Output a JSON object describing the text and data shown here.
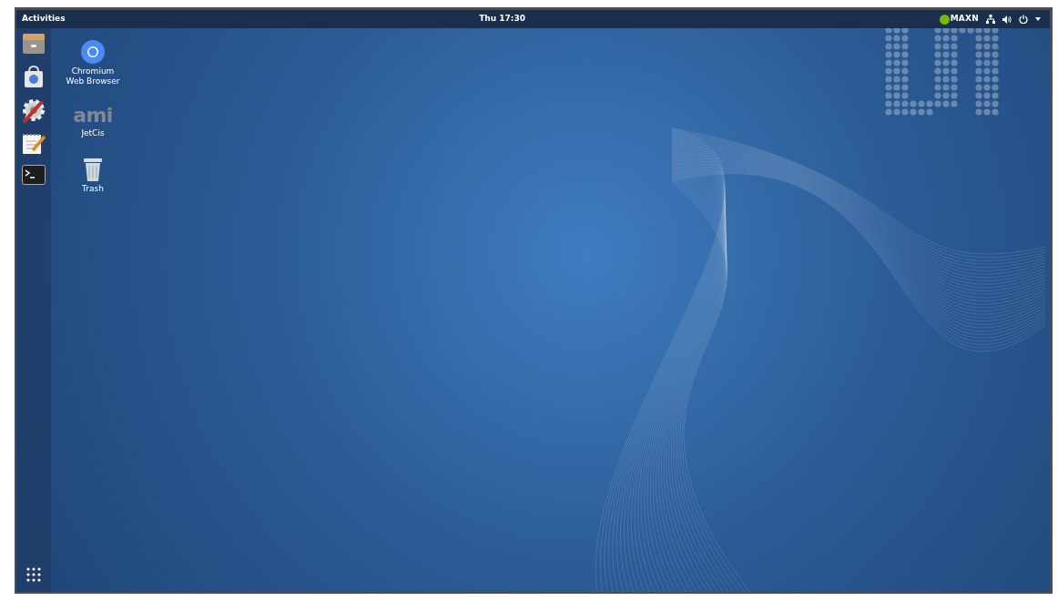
{
  "top_bar": {
    "activities": "Activities",
    "clock": "Thu 17:30",
    "power_mode": "MAXN"
  },
  "dock": {
    "apps": [
      {
        "kind": "files"
      },
      {
        "kind": "software"
      },
      {
        "kind": "settings"
      },
      {
        "kind": "editor"
      },
      {
        "kind": "terminal"
      }
    ]
  },
  "desktop_icons": [
    {
      "kind": "chromium",
      "label": "Chromium Web Browser"
    },
    {
      "kind": "ami",
      "logo": "ami",
      "label": "JetCis"
    },
    {
      "kind": "trash",
      "label": "Trash"
    }
  ]
}
